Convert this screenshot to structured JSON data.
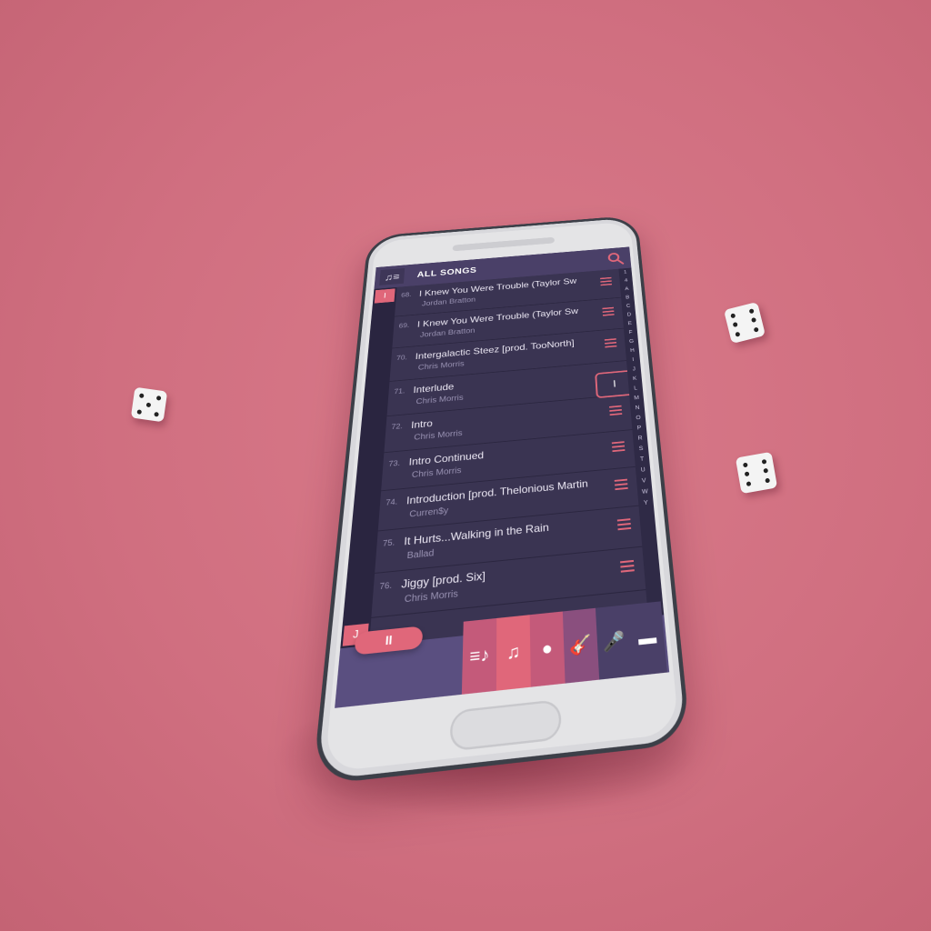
{
  "topbar": {
    "title": "ALL SONGS",
    "menu_icon": "music-list-icon",
    "search_icon": "search-icon"
  },
  "rail": {
    "current_letter": "I",
    "next_letter": "J"
  },
  "songs": [
    {
      "num": "68.",
      "title": "I Knew You Were Trouble (Taylor Sw",
      "artist": "Jordan Bratton"
    },
    {
      "num": "69.",
      "title": "I Knew You Were Trouble (Taylor Sw",
      "artist": "Jordan Bratton"
    },
    {
      "num": "70.",
      "title": "Intergalactic Steez [prod. TooNorth]",
      "artist": "Chris Morris"
    },
    {
      "num": "71.",
      "title": "Interlude",
      "artist": "Chris Morris"
    },
    {
      "num": "72.",
      "title": "Intro",
      "artist": "Chris Morris"
    },
    {
      "num": "73.",
      "title": "Intro Continued",
      "artist": "Chris Morris"
    },
    {
      "num": "74.",
      "title": "Introduction [prod. Thelonious Martin",
      "artist": "Curren$y"
    },
    {
      "num": "75.",
      "title": "It Hurts...Walking in the Rain",
      "artist": "Ballad"
    },
    {
      "num": "76.",
      "title": "Jiggy [prod. Six]",
      "artist": "Chris Morris"
    }
  ],
  "popup_letter": "I",
  "alpha_index": [
    "1",
    "4",
    "A",
    "B",
    "C",
    "D",
    "E",
    "F",
    "G",
    "H",
    "I",
    "J",
    "K",
    "L",
    "M",
    "N",
    "O",
    "P",
    "R",
    "S",
    "T",
    "U",
    "V",
    "W",
    "Y"
  ],
  "player": {
    "pause_label": "II"
  },
  "nav_tabs": [
    {
      "icon": "playlist-icon",
      "glyph": "≡♪",
      "color": "#c45a7a"
    },
    {
      "icon": "songs-icon",
      "glyph": "♫",
      "color": "#e0677a"
    },
    {
      "icon": "album-icon",
      "glyph": "●",
      "color": "#c45a7a"
    },
    {
      "icon": "guitar-icon",
      "glyph": "🎸",
      "color": "#8a4f7e"
    },
    {
      "icon": "microphone-icon",
      "glyph": "🎤",
      "color": "#4a4068"
    },
    {
      "icon": "folder-icon",
      "glyph": "▬",
      "color": "#4a4068"
    }
  ],
  "colors": {
    "accent": "#e0677a",
    "primary": "#4a4068",
    "background": "#d06f80"
  }
}
